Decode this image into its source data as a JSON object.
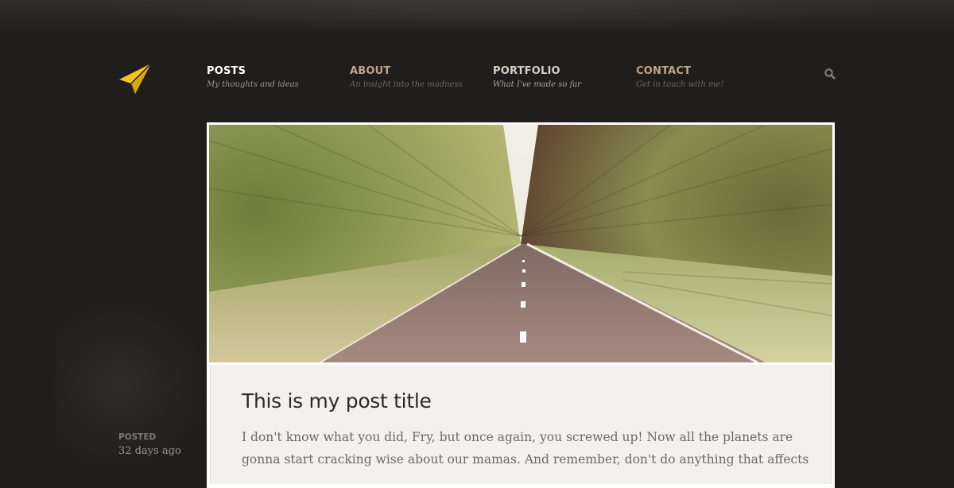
{
  "nav": {
    "items": [
      {
        "label": "POSTS",
        "sub": "My thoughts and ideas"
      },
      {
        "label": "ABOUT",
        "sub": "An insight into the madness"
      },
      {
        "label": "PORTFOLIO",
        "sub": "What I've made so far"
      },
      {
        "label": "CONTACT",
        "sub": "Get in touch with me!"
      }
    ],
    "active_index": 0
  },
  "icons": {
    "logo": "paper-plane-icon",
    "search": "search-icon"
  },
  "colors": {
    "background": "#1f1e1c",
    "logo": "#f5c518",
    "nav_active": "#ffffff",
    "nav_inactive": "#bfa58a",
    "post_background": "#f4f1ed"
  },
  "post": {
    "title": "This is my post title",
    "excerpt": "I don't know what you did, Fry, but once again, you screwed up! Now all the planets are gonna start cracking wise about our mamas. And remember, don't do anything that affects",
    "meta_label": "POSTED",
    "meta_value": "32 days ago"
  }
}
